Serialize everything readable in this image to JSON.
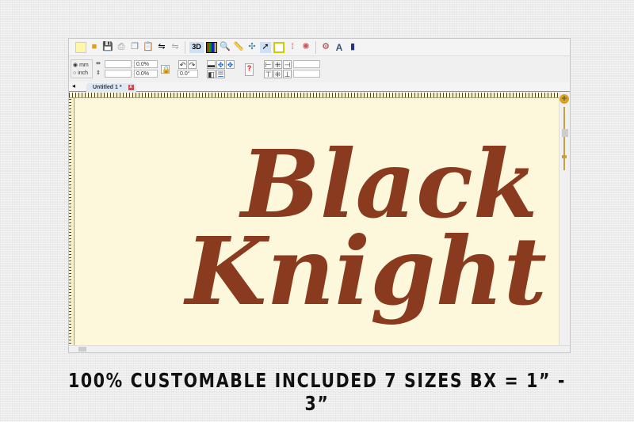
{
  "toolbar": {
    "icons": [
      "new-icon",
      "open-icon",
      "save-icon",
      "print-icon",
      "copy-icon",
      "paste-icon",
      "mirror-icon",
      "mirror-disabled-icon",
      "3d-view-icon",
      "color-chart-icon",
      "zoom-icon",
      "ruler-icon",
      "stitch-icon",
      "select-icon",
      "properties-icon",
      "color-sequence-icon",
      "network-icon",
      "settings-icon",
      "text-icon",
      "export-icon"
    ],
    "label_3d": "3D",
    "label_text": "A"
  },
  "properties": {
    "unit_mm": "mm",
    "unit_inch": "inch",
    "width_value": "",
    "height_value": "",
    "width_pct": "0.0%",
    "height_pct": "0.0%",
    "angle": "0.0°"
  },
  "tab": {
    "nav": "◂",
    "title": "Untitled 1 *",
    "close": "x"
  },
  "design": {
    "line1": "Black",
    "line2": "Knight",
    "thread_color": "#8a3a1e",
    "canvas_color": "#fdf8dc"
  },
  "caption": "100% CUSTOMABLE INCLUDED 7 SIZES BX = 1” -  3”"
}
